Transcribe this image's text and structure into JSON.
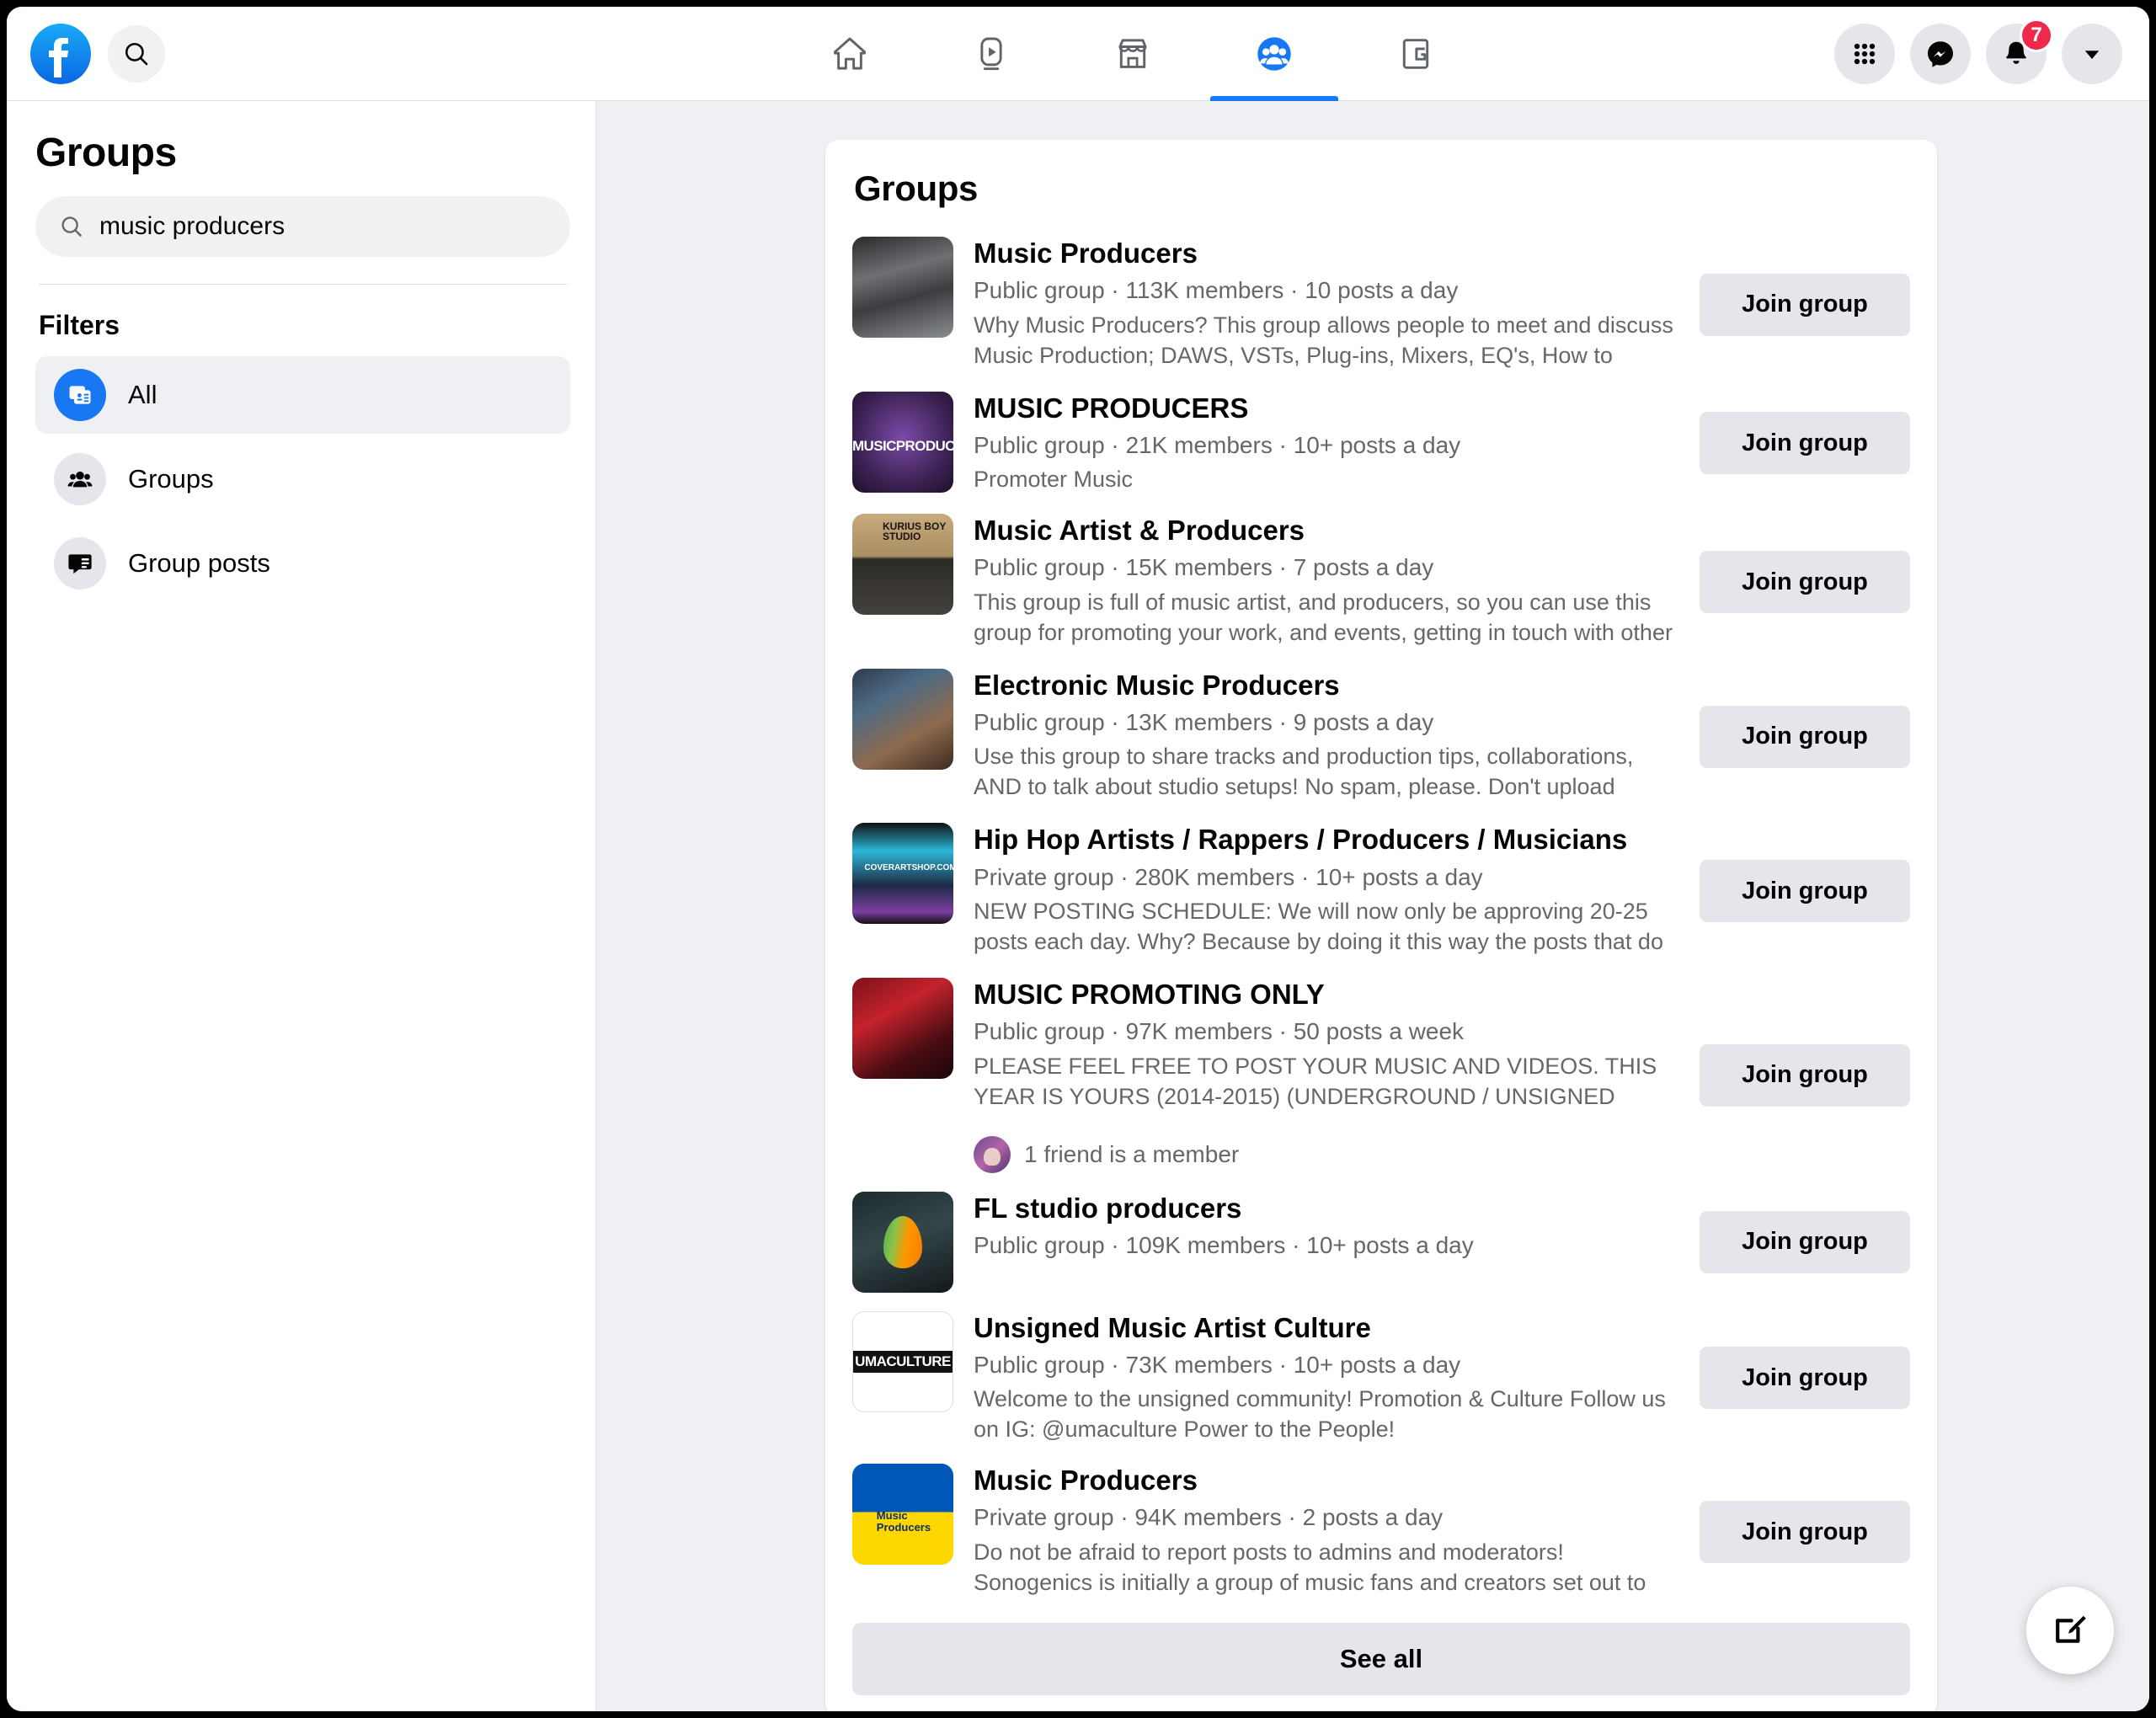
{
  "topbar": {
    "logo_icon": "facebook-logo-icon",
    "search_icon": "search-icon",
    "nav": [
      {
        "icon": "home-icon",
        "label": "Home",
        "active": false
      },
      {
        "icon": "video-icon",
        "label": "Video",
        "active": false
      },
      {
        "icon": "marketplace-icon",
        "label": "Marketplace",
        "active": false
      },
      {
        "icon": "groups-icon",
        "label": "Groups",
        "active": true
      },
      {
        "icon": "gaming-icon",
        "label": "Gaming",
        "active": false
      }
    ],
    "actions": [
      {
        "icon": "menu-grid-icon",
        "label": "Menu"
      },
      {
        "icon": "messenger-icon",
        "label": "Messenger"
      },
      {
        "icon": "bell-icon",
        "label": "Notifications",
        "badge": "7"
      },
      {
        "icon": "chevron-down-icon",
        "label": "Account"
      }
    ]
  },
  "sidebar": {
    "title": "Groups",
    "search": {
      "value": "music producers",
      "placeholder": "Search groups",
      "icon": "search-icon"
    },
    "filters_label": "Filters",
    "filters": [
      {
        "label": "All",
        "icon": "all-results-icon",
        "active": true
      },
      {
        "label": "Groups",
        "icon": "people-icon",
        "active": false
      },
      {
        "label": "Group posts",
        "icon": "chat-bubble-icon",
        "active": false
      }
    ]
  },
  "main": {
    "card_title": "Groups",
    "see_all_label": "See all",
    "join_label": "Join group",
    "compose_icon": "compose-icon",
    "groups": [
      {
        "name": "Music Producers",
        "meta": "Public group · 113K members · 10 posts a day",
        "privacy": "Public group",
        "members": "113K members",
        "posts": "10 posts a day",
        "description": "Why Music Producers? This group allows people to meet and discuss Music Production; DAWS, VSTs, Plug-ins, Mixers, EQ's, How to Record,...",
        "friend_line": null,
        "avatar_style": "photo-mixing-console"
      },
      {
        "name": "MUSIC PRODUCERS",
        "meta": "Public group · 21K members · 10+ posts a day",
        "privacy": "Public group",
        "members": "21K members",
        "posts": "10+ posts a day",
        "description": "Promoter Music",
        "friend_line": null,
        "avatar_style": "photo-purple-badge"
      },
      {
        "name": "Music Artist & Producers",
        "meta": "Public group · 15K members · 7 posts a day",
        "privacy": "Public group",
        "members": "15K members",
        "posts": "7 posts a day",
        "description": "This group is full of music artist, and producers, so you can use this group for promoting your work, and events, getting in touch with other music...",
        "friend_line": null,
        "avatar_style": "photo-kurius-studio"
      },
      {
        "name": "Electronic Music Producers",
        "meta": "Public group · 13K members · 9 posts a day",
        "privacy": "Public group",
        "members": "13K members",
        "posts": "9 posts a day",
        "description": "Use this group to share tracks and production tips, collaborations, AND to talk about studio setups! No spam, please. Don't upload tracks just to...",
        "friend_line": null,
        "avatar_style": "photo-synth-studio"
      },
      {
        "name": "Hip Hop Artists / Rappers / Producers / Musicians",
        "meta": "Private group · 280K members · 10+ posts a day",
        "privacy": "Private group",
        "members": "280K members",
        "posts": "10+ posts a day",
        "description": "NEW POSTING SCHEDULE: We will now only be approving 20-25 posts each day. Why? Because by doing it this way the posts that do get...",
        "friend_line": null,
        "avatar_style": "photo-coverart-phone"
      },
      {
        "name": "MUSIC PROMOTING ONLY",
        "meta": "Public group · 97K members · 50 posts a week",
        "privacy": "Public group",
        "members": "97K members",
        "posts": "50 posts a week",
        "description": "PLEASE FEEL FREE TO POST YOUR MUSIC AND VIDEOS. THIS YEAR IS YOURS (2014-2015) (UNDERGROUND / UNSIGNED ARTIST ONLY)...",
        "friend_line": "1 friend is a member",
        "avatar_style": "photo-red-corridor"
      },
      {
        "name": "FL studio producers",
        "meta": "Public group · 109K members · 10+ posts a day",
        "privacy": "Public group",
        "members": "109K members",
        "posts": "10+ posts a day",
        "description": "",
        "friend_line": null,
        "avatar_style": "photo-fl-fruit"
      },
      {
        "name": "Unsigned Music Artist Culture",
        "meta": "Public group · 73K members · 10+ posts a day",
        "privacy": "Public group",
        "members": "73K members",
        "posts": "10+ posts a day",
        "description": "Welcome to the unsigned community! Promotion & Culture Follow us on IG: @umaculture Power to the People!",
        "friend_line": null,
        "avatar_style": "logo-uma-culture"
      },
      {
        "name": "Music Producers",
        "meta": "Private group · 94K members · 2 posts a day",
        "privacy": "Private group",
        "members": "94K members",
        "posts": "2 posts a day",
        "description": "Do not be afraid to report posts to admins and moderators! Sonogenics is initially a group of music fans and creators set out to establish a platform...",
        "friend_line": null,
        "avatar_style": "logo-blue-yellow"
      }
    ]
  },
  "colors": {
    "brand_blue": "#1877f2",
    "badge_red": "#f02849",
    "page_bg": "#eef0f3",
    "button_gray": "#e4e6eb",
    "text_primary": "#050505",
    "text_secondary": "#65676b"
  }
}
